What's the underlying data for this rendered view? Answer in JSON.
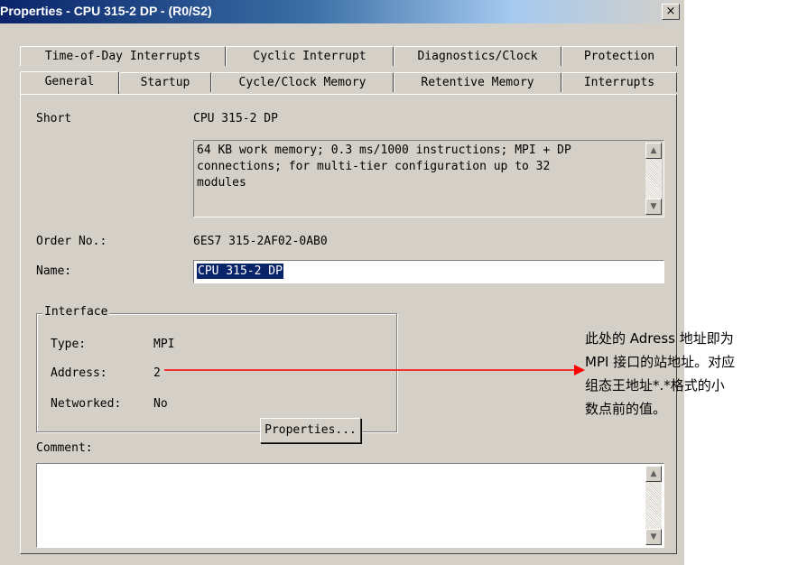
{
  "window": {
    "title": "Properties - CPU 315-2 DP - (R0/S2)",
    "close_glyph": "×"
  },
  "tabs_row1": [
    "Time-of-Day Interrupts",
    "Cyclic Interrupt",
    "Diagnostics/Clock",
    "Protection"
  ],
  "tabs_row2": [
    "General",
    "Startup",
    "Cycle/Clock Memory",
    "Retentive Memory",
    "Interrupts"
  ],
  "active_tab": "General",
  "general": {
    "short_label": "Short",
    "short_value": "CPU 315-2 DP",
    "description": "64 KB work memory; 0.3 ms/1000 instructions; MPI + DP\nconnections; for multi-tier configuration up to 32\nmodules",
    "order_label": "Order No.:",
    "order_value": "6ES7 315-2AF02-0AB0",
    "name_label": "Name:",
    "name_value": "CPU 315-2 DP",
    "comment_label": "Comment:"
  },
  "interface": {
    "title": "Interface",
    "type_label": "Type:",
    "type_value": "MPI",
    "address_label": "Address:",
    "address_value": "2",
    "networked_label": "Networked:",
    "networked_value": "No",
    "properties_button": "Properties..."
  },
  "annotation": {
    "lines": [
      "此处的 Adress 地址即为",
      "MPI 接口的站地址。对应",
      "组态王地址*.*格式的小",
      "数点前的值。"
    ],
    "arrow_color": "#ff0000"
  },
  "icons": {
    "scroll_up": "▲",
    "scroll_down": "▼"
  }
}
